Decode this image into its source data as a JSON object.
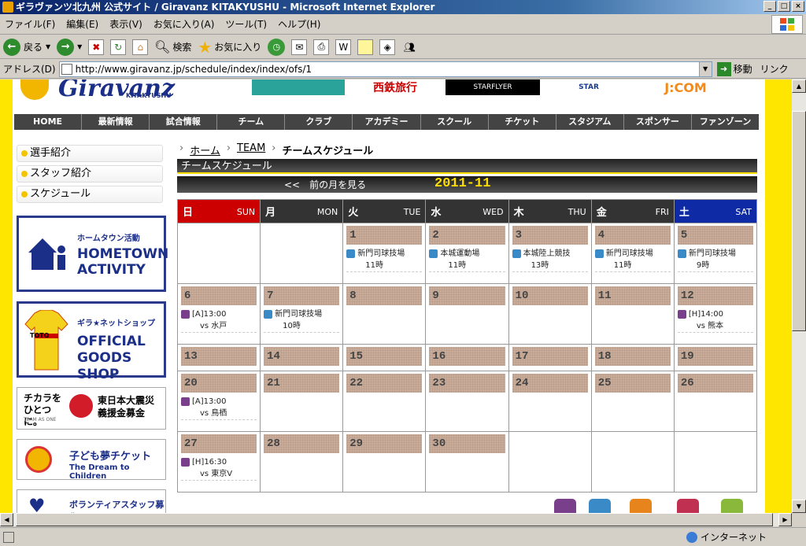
{
  "window": {
    "title": "ギラヴァンツ北九州 公式サイト / Giravanz KITAKYUSHU - Microsoft Internet Explorer",
    "buttons": [
      "_",
      "□",
      "×"
    ]
  },
  "menu": [
    "ファイル(F)",
    "編集(E)",
    "表示(V)",
    "お気に入り(A)",
    "ツール(T)",
    "ヘルプ(H)"
  ],
  "toolbar": {
    "back": "戻る",
    "search": "検索",
    "favorites": "お気に入り"
  },
  "address": {
    "label": "アドレス(D)",
    "url": "http://www.giravanz.jp/schedule/index/index/ofs/1",
    "go": "移動",
    "links": "リンク"
  },
  "site": {
    "logo": "Giravanz",
    "logo_sub": "KITAKYUSHU",
    "sponsors": [
      "西鉄旅行",
      "STARFLYER",
      "STAR",
      "J:COM"
    ],
    "nav": [
      "HOME",
      "最新情報",
      "試合情報",
      "チーム",
      "クラブ",
      "アカデミー",
      "スクール",
      "チケット",
      "スタジアム",
      "スポンサー",
      "ファンゾーン"
    ]
  },
  "sidebar": {
    "items": [
      "選手紹介",
      "スタッフ紹介",
      "スケジュール"
    ],
    "banners": {
      "hometown_jp": "ホームタウン活動",
      "hometown_en": "HOMETOWN ACTIVITY",
      "shop_jp": "ギラ★ネットショップ",
      "shop_en": "OFFICIAL GOODS SHOP",
      "shop_shirt": "TOTO",
      "quake_left": "チカラを ひとつに。",
      "quake_sub": "TEAM AS ONE",
      "quake_right": "東日本大震災 義援金募金",
      "dream_jp": "子ども夢チケット",
      "dream_en": "The Dream to Children",
      "volunteer": "ボランティアスタッフ募集"
    }
  },
  "breadcrumb": [
    "ホーム",
    "TEAM",
    "チームスケジュール"
  ],
  "schedule": {
    "heading": "チームスケジュール",
    "prev_month": "<<　前の月を見る",
    "current_month": "2011-11",
    "days": [
      {
        "jp": "日",
        "en": "SUN"
      },
      {
        "jp": "月",
        "en": "MON"
      },
      {
        "jp": "火",
        "en": "TUE"
      },
      {
        "jp": "水",
        "en": "WED"
      },
      {
        "jp": "木",
        "en": "THU"
      },
      {
        "jp": "金",
        "en": "FRI"
      },
      {
        "jp": "土",
        "en": "SAT"
      }
    ],
    "weeks": [
      [
        null,
        null,
        {
          "day": "1",
          "ev": [
            {
              "t": "tr",
              "l1": "新門司球技場",
              "l2": "11時"
            }
          ]
        },
        {
          "day": "2",
          "ev": [
            {
              "t": "tr",
              "l1": "本城運動場",
              "l2": "11時"
            }
          ]
        },
        {
          "day": "3",
          "ev": [
            {
              "t": "tr",
              "l1": "本城陸上競技",
              "l2": "13時"
            }
          ]
        },
        {
          "day": "4",
          "ev": [
            {
              "t": "tr",
              "l1": "新門司球技場",
              "l2": "11時"
            }
          ]
        },
        {
          "day": "5",
          "ev": [
            {
              "t": "tr",
              "l1": "新門司球技場",
              "l2": "9時"
            }
          ]
        }
      ],
      [
        {
          "day": "6",
          "ev": [
            {
              "t": "gm",
              "l1": "[A]13:00",
              "l2": "vs 水戸"
            }
          ]
        },
        {
          "day": "7",
          "ev": [
            {
              "t": "tr",
              "l1": "新門司球技場",
              "l2": "10時"
            }
          ]
        },
        {
          "day": "8"
        },
        {
          "day": "9"
        },
        {
          "day": "10"
        },
        {
          "day": "11"
        },
        {
          "day": "12",
          "ev": [
            {
              "t": "gm",
              "l1": "[H]14:00",
              "l2": "vs 熊本"
            }
          ]
        }
      ],
      [
        {
          "day": "13"
        },
        {
          "day": "14"
        },
        {
          "day": "15"
        },
        {
          "day": "16"
        },
        {
          "day": "17"
        },
        {
          "day": "18"
        },
        {
          "day": "19"
        }
      ],
      [
        {
          "day": "20",
          "ev": [
            {
              "t": "gm",
              "l1": "[A]13:00",
              "l2": "vs 鳥栖"
            }
          ]
        },
        {
          "day": "21"
        },
        {
          "day": "22"
        },
        {
          "day": "23"
        },
        {
          "day": "24"
        },
        {
          "day": "25"
        },
        {
          "day": "26"
        }
      ],
      [
        {
          "day": "27",
          "ev": [
            {
              "t": "gm",
              "l1": "[H]16:30",
              "l2": "vs 東京V"
            }
          ]
        },
        {
          "day": "28"
        },
        {
          "day": "29"
        },
        {
          "day": "30"
        },
        null,
        null,
        null
      ]
    ]
  },
  "status": {
    "zone": "インターネット"
  },
  "colors": {
    "sunday": "#cc0000",
    "saturday": "#0e2aa4",
    "accent": "#ffde00"
  }
}
